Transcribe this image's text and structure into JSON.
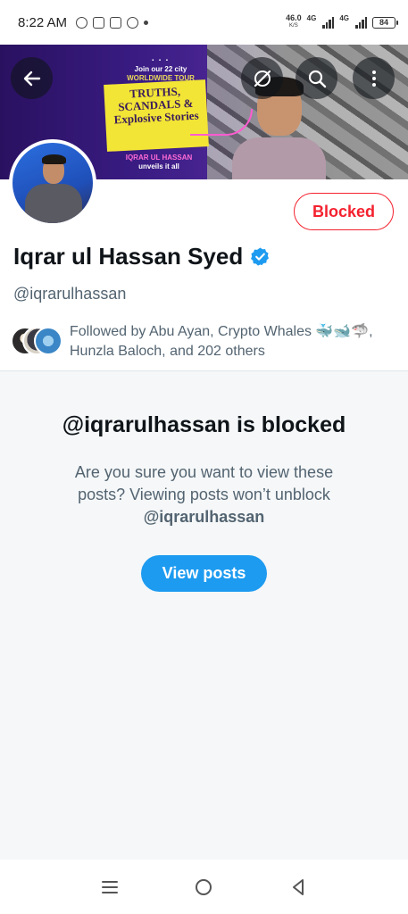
{
  "status_bar": {
    "time": "8:22 AM",
    "net_speed": "46.0",
    "net_unit": "K/S",
    "network_1": "4G",
    "network_2": "4G",
    "battery": "84"
  },
  "banner": {
    "tour_line_1": "Join our 22 city",
    "tour_line_2": "WORLDWIDE TOUR",
    "headline": "TRUTHS, SCANDALS & Explosive Stories",
    "name_line_1": "IQRAR UL HASSAN",
    "name_line_2": "unveils it all"
  },
  "header_buttons": {
    "back_icon": "arrow-left-icon",
    "grok_icon": "slash-circle-icon",
    "search_icon": "search-icon",
    "more_icon": "more-vertical-icon"
  },
  "profile": {
    "name": "Iqrar ul Hassan Syed",
    "handle": "@iqrarulhassan",
    "blocked_label": "Blocked",
    "followed_by": "Followed by Abu Ayan, Crypto Whales 🐳🐋🦈, Hunzla Baloch, and 202 others",
    "verified_color": "#1d9bf0"
  },
  "blocked_notice": {
    "title": "@iqrarulhassan is blocked",
    "description": "Are you sure you want to view these posts? Viewing posts won’t unblock",
    "handle": "@iqrarulhassan",
    "button_label": "View posts"
  },
  "colors": {
    "accent": "#1d9bf0",
    "danger": "#f4212e",
    "muted": "#536471"
  }
}
